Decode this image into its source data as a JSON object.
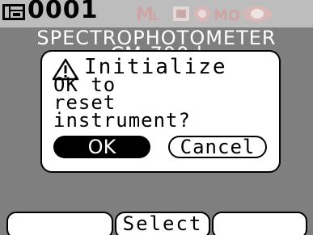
{
  "status_bar": {
    "memory_icon": "memory-card-icon",
    "sample_number": "0001",
    "status_icons": [
      "measurement-mode-icon",
      "area-icon",
      "specular-icon",
      "mode-icon",
      "light-source-icon"
    ]
  },
  "header": {
    "title": "SPECTROPHOTOMETER",
    "model": "CM-700d"
  },
  "dialog": {
    "icon": "warning-icon",
    "title": "Initialize",
    "message_lines": [
      "OK to",
      "reset",
      "instrument?"
    ],
    "ok_label": "OK",
    "cancel_label": "Cancel"
  },
  "softkeys": {
    "left_label": "",
    "middle_label": "Select",
    "right_label": ""
  },
  "colors": {
    "screen_background": "#7f7f7f",
    "status_bar_background": "#bdbdbd",
    "dialog_background": "#ffffff",
    "selected_button": "#000000"
  }
}
